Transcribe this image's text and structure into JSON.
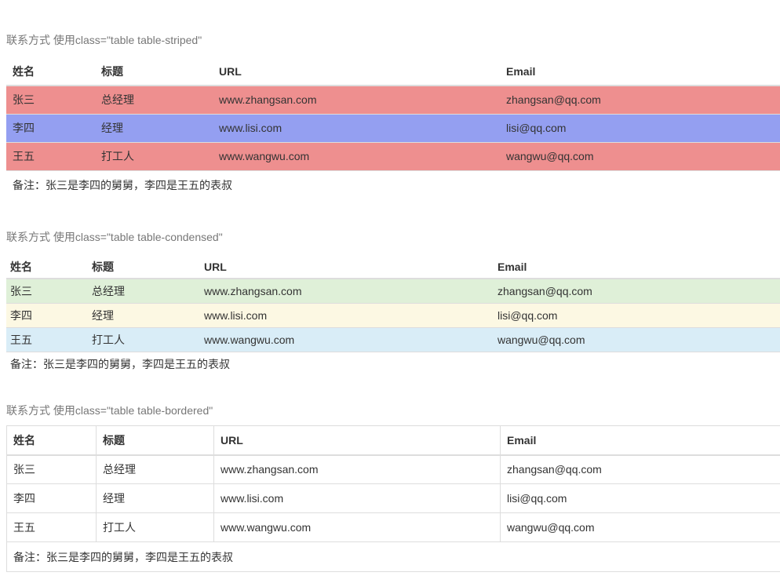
{
  "colors": {
    "caption": "#777777",
    "text": "#333333",
    "border": "#dddddd",
    "striped_rows": [
      "#ee8f8f",
      "#949ff1",
      "#ee8f8f"
    ],
    "condensed_rows": [
      "#dff0d8",
      "#fcf8e3",
      "#d9edf7"
    ],
    "bordered_rows": [
      "#ffffff",
      "#ffffff",
      "#ffffff"
    ]
  },
  "sections": {
    "striped": {
      "caption": "联系方式 使用class=\"table table-striped\"",
      "headers": [
        "姓名",
        "标题",
        "URL",
        "Email"
      ],
      "rows": [
        [
          "张三",
          "总经理",
          "www.zhangsan.com",
          "zhangsan@qq.com"
        ],
        [
          "李四",
          "经理",
          "www.lisi.com",
          "lisi@qq.com"
        ],
        [
          "王五",
          "打工人",
          "www.wangwu.com",
          "wangwu@qq.com"
        ]
      ],
      "note": "备注：张三是李四的舅舅，李四是王五的表叔"
    },
    "condensed": {
      "caption": "联系方式 使用class=\"table table-condensed\"",
      "headers": [
        "姓名",
        "标题",
        "URL",
        "Email"
      ],
      "rows": [
        [
          "张三",
          "总经理",
          "www.zhangsan.com",
          "zhangsan@qq.com"
        ],
        [
          "李四",
          "经理",
          "www.lisi.com",
          "lisi@qq.com"
        ],
        [
          "王五",
          "打工人",
          "www.wangwu.com",
          "wangwu@qq.com"
        ]
      ],
      "note": "备注：张三是李四的舅舅，李四是王五的表叔"
    },
    "bordered": {
      "caption": "联系方式 使用class=\"table table-bordered\"",
      "headers": [
        "姓名",
        "标题",
        "URL",
        "Email"
      ],
      "rows": [
        [
          "张三",
          "总经理",
          "www.zhangsan.com",
          "zhangsan@qq.com"
        ],
        [
          "李四",
          "经理",
          "www.lisi.com",
          "lisi@qq.com"
        ],
        [
          "王五",
          "打工人",
          "www.wangwu.com",
          "wangwu@qq.com"
        ]
      ],
      "note": "备注：张三是李四的舅舅，李四是王五的表叔"
    }
  }
}
